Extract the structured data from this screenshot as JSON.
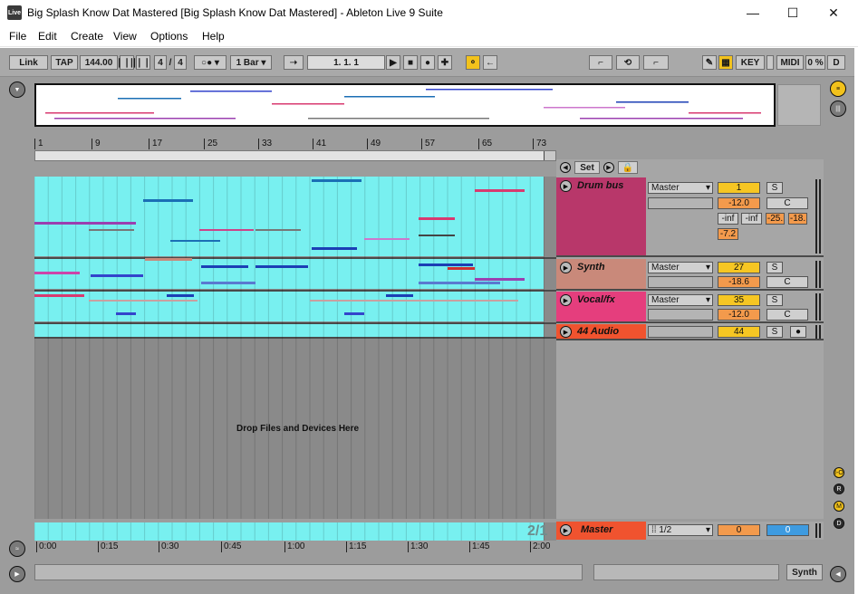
{
  "window": {
    "icon": "Live",
    "title": "Big Splash Know Dat Mastered  [Big Splash Know Dat Mastered] - Ableton Live 9 Suite",
    "minimize": "—",
    "maximize": "☐",
    "close": "✕"
  },
  "menu": [
    "File",
    "Edit",
    "Create",
    "View",
    "Options",
    "Help"
  ],
  "control_bar": {
    "link": "Link",
    "tap": "TAP",
    "tempo": "144.00",
    "sig_num": "4",
    "sig_slash": "/",
    "sig_den": "4",
    "quantize": "1 Bar",
    "position": "1.    1.    1",
    "key": "KEY",
    "midi": "MIDI",
    "cpu": "0 %",
    "disk": "D"
  },
  "ruler": {
    "bars": [
      "1",
      "9",
      "17",
      "25",
      "33",
      "41",
      "49",
      "57",
      "65",
      "73"
    ]
  },
  "arrangement": {
    "drop_text": "Drop Files and Devices Here",
    "loop_indicator": "2/1"
  },
  "mixer": {
    "set_label": "Set",
    "tracks": [
      {
        "name": "Drum bus",
        "color": "#b8376a",
        "route": "Master",
        "number": "1",
        "volume": "-12.0",
        "pan": "C",
        "solo": "S",
        "peaks": [
          "-inf",
          "-inf",
          "-25.",
          "-18."
        ],
        "extra": "-7.2"
      },
      {
        "name": "Synth",
        "color": "#c9897a",
        "route": "Master",
        "number": "27",
        "volume": "-18.6",
        "pan": "C",
        "solo": "S"
      },
      {
        "name": "Vocal/fx",
        "color": "#e53e7d",
        "route": "Master",
        "number": "35",
        "volume": "-12.0",
        "pan": "C",
        "solo": "S"
      },
      {
        "name": "44 Audio",
        "color": "#f0532f",
        "route": "",
        "number": "44",
        "solo": "S"
      }
    ],
    "master": {
      "name": "Master",
      "color": "#f0532f",
      "route": "1/2",
      "value_a": "0",
      "value_b": "0"
    }
  },
  "time_ruler": [
    "0:00",
    "0:15",
    "0:30",
    "0:45",
    "1:00",
    "1:15",
    "1:30",
    "1:45",
    "2:00"
  ],
  "side_buttons": [
    "I-O",
    "R",
    "M",
    "D"
  ],
  "status": {
    "device_label": "Synth"
  }
}
